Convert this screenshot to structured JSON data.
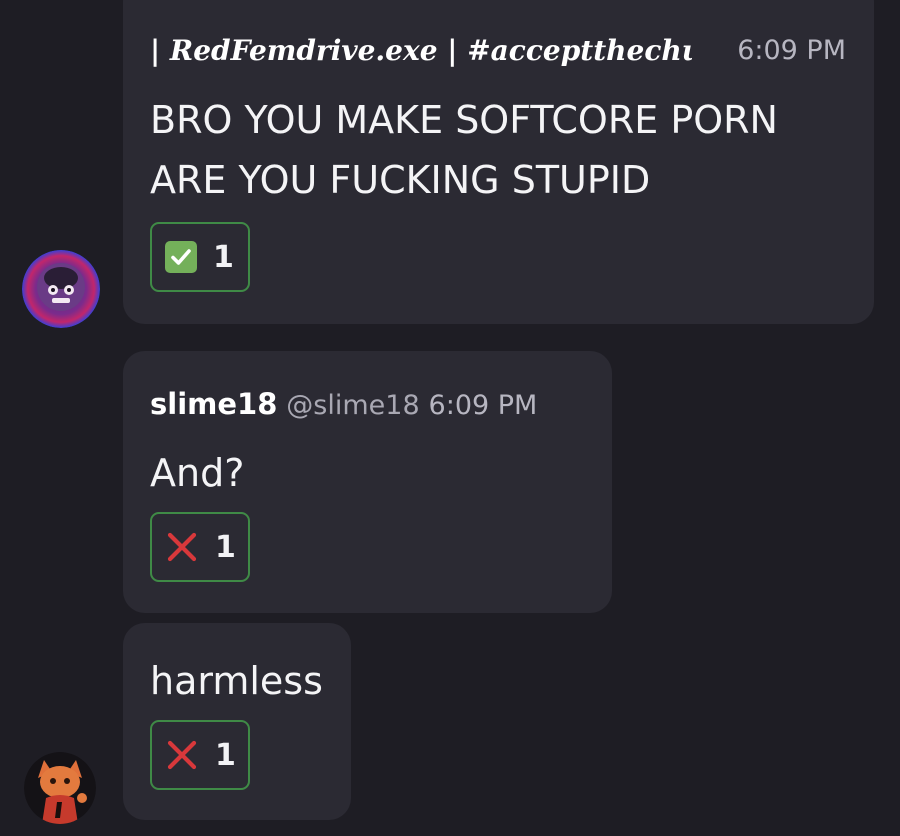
{
  "messages": [
    {
      "author": "| RedFemdrive.exe | #acceptthechurchofamanda",
      "time": "6:09 PM",
      "text_line1": "BRO YOU MAKE SOFTCORE PORN",
      "text_line2": "ARE YOU FUCKING STUPID",
      "reaction": {
        "emoji": "check-mark-button-icon",
        "count": "1"
      }
    },
    {
      "author": "slime18",
      "handle": "@slime18",
      "time": "6:09 PM",
      "text": "And?",
      "reaction": {
        "emoji": "cross-mark-icon",
        "count": "1"
      }
    },
    {
      "text": "harmless",
      "reaction": {
        "emoji": "cross-mark-icon",
        "count": "1"
      }
    }
  ],
  "colors": {
    "background": "#1e1d24",
    "bubble": "#2b2a33",
    "reaction_border": "#3f8a46",
    "check_green": "#74b05a",
    "cross_red": "#d8383b"
  }
}
